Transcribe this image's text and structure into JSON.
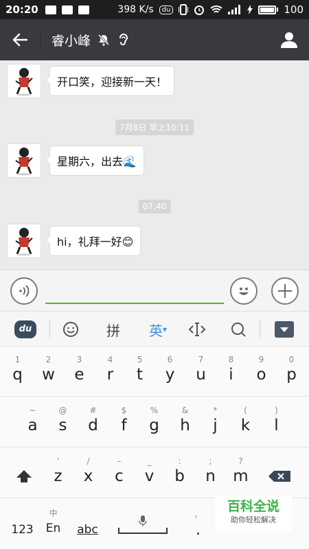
{
  "status_bar": {
    "time": "20:20",
    "speed": "398 K/s",
    "baidu_badge": "du",
    "battery": "100"
  },
  "title_bar": {
    "title": "睿小峰",
    "icons": [
      "back-arrow-icon",
      "muted-bell-icon",
      "ear-icon",
      "profile-icon"
    ]
  },
  "chat": {
    "messages": [
      {
        "text": "开口笑，迎接新一天！"
      },
      {
        "text": "星期六，出去🌊"
      },
      {
        "text": "hi，礼拜一好😊"
      }
    ],
    "timestamps": [
      "7月8日 早上10:11",
      "07:40"
    ]
  },
  "ime_toolbar": {
    "logo": "du",
    "pinyin": "拼",
    "english": "英",
    "english_caret": "▾",
    "accent_color": "#3f8ee6"
  },
  "keyboard": {
    "row1": [
      {
        "hint": "1",
        "key": "q"
      },
      {
        "hint": "2",
        "key": "w"
      },
      {
        "hint": "3",
        "key": "e"
      },
      {
        "hint": "4",
        "key": "r"
      },
      {
        "hint": "5",
        "key": "t"
      },
      {
        "hint": "6",
        "key": "y"
      },
      {
        "hint": "7",
        "key": "u"
      },
      {
        "hint": "8",
        "key": "i"
      },
      {
        "hint": "9",
        "key": "o"
      },
      {
        "hint": "0",
        "key": "p"
      }
    ],
    "row2": [
      {
        "hint": "~",
        "key": "a"
      },
      {
        "hint": "@",
        "key": "s"
      },
      {
        "hint": "#",
        "key": "d"
      },
      {
        "hint": "$",
        "key": "f"
      },
      {
        "hint": "%",
        "key": "g"
      },
      {
        "hint": "&",
        "key": "h"
      },
      {
        "hint": "*",
        "key": "j"
      },
      {
        "hint": "(",
        "key": "k"
      },
      {
        "hint": ")",
        "key": "l"
      }
    ],
    "row3": [
      {
        "hint": "'",
        "key": "z"
      },
      {
        "hint": "/",
        "key": "x"
      },
      {
        "hint": "–",
        "key": "c"
      },
      {
        "hint": "_",
        "key": "v"
      },
      {
        "hint": ":",
        "key": "b"
      },
      {
        "hint": ";",
        "key": "n"
      },
      {
        "hint": "?",
        "key": "m"
      }
    ],
    "bottom": {
      "num": "123",
      "lang_hint": "中",
      "lang": "En",
      "abc": "abc",
      "comma": "，",
      "period_hint": "，",
      "period": "."
    }
  },
  "watermark": {
    "title": "百科全说",
    "subtitle": "助你轻松解决"
  }
}
